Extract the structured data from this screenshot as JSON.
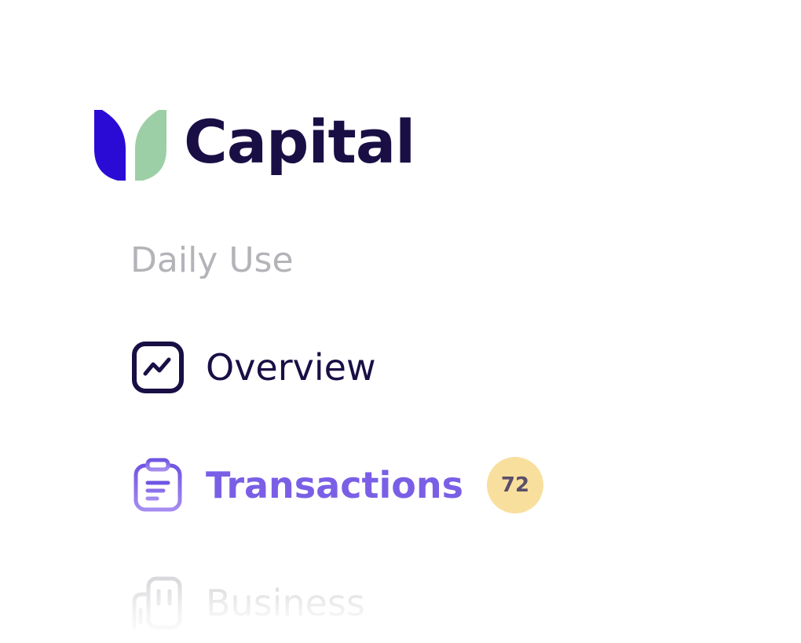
{
  "brand": {
    "name": "Capital",
    "mark_left_color": "#2a0bd6",
    "mark_right_color": "#9dcfa6",
    "text_color": "#1a0f45"
  },
  "nav": {
    "section_label": "Daily Use",
    "items": [
      {
        "label": "Overview",
        "icon": "chart-trend-icon",
        "state": "default"
      },
      {
        "label": "Transactions",
        "icon": "clipboard-icon",
        "state": "active",
        "badge": "72"
      },
      {
        "label": "Business",
        "icon": "building-icon",
        "state": "faded"
      }
    ]
  },
  "colors": {
    "active": "#7a5fe6",
    "default": "#1a0f45",
    "muted": "#b3b3b8",
    "badge_bg": "#f9df9e"
  }
}
